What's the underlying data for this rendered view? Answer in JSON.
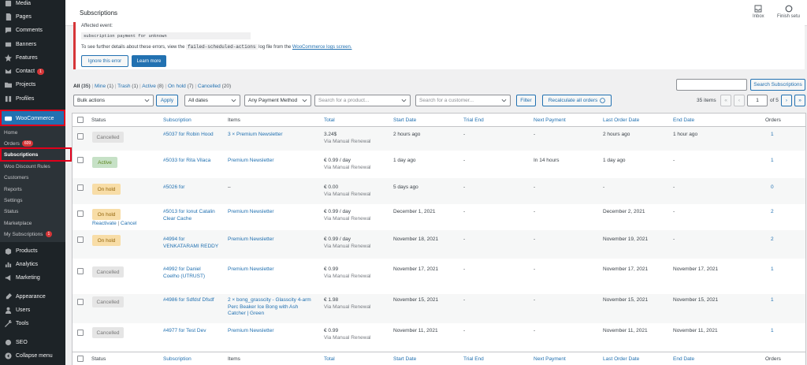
{
  "sidebar": {
    "items": [
      {
        "label": "Media",
        "icon": "media-icon"
      },
      {
        "label": "Pages",
        "icon": "pages-icon"
      },
      {
        "label": "Comments",
        "icon": "comments-icon"
      },
      {
        "label": "Banners",
        "icon": "banners-icon"
      },
      {
        "label": "Features",
        "icon": "features-icon"
      },
      {
        "label": "Contact",
        "icon": "contact-icon",
        "badge": "1"
      },
      {
        "label": "Projects",
        "icon": "projects-icon"
      },
      {
        "label": "Profiles",
        "icon": "profiles-icon"
      }
    ],
    "woocommerce": "WooCommerce",
    "submenu": [
      {
        "label": "Home"
      },
      {
        "label": "Orders",
        "badge": "609"
      },
      {
        "label": "Subscriptions"
      },
      {
        "label": "Woo Discount Rules"
      },
      {
        "label": "Customers"
      },
      {
        "label": "Reports"
      },
      {
        "label": "Settings"
      },
      {
        "label": "Status"
      },
      {
        "label": "Marketplace"
      },
      {
        "label": "My Subscriptions",
        "badge": "1"
      }
    ],
    "items2": [
      {
        "label": "Products",
        "icon": "products-icon"
      },
      {
        "label": "Analytics",
        "icon": "analytics-icon"
      },
      {
        "label": "Marketing",
        "icon": "marketing-icon"
      },
      {
        "label": "Appearance",
        "icon": "appearance-icon"
      },
      {
        "label": "Users",
        "icon": "users-icon"
      },
      {
        "label": "Tools",
        "icon": "tools-icon"
      },
      {
        "label": "SEO",
        "icon": "seo-icon"
      },
      {
        "label": "Collapse menu",
        "icon": "collapse-icon"
      }
    ]
  },
  "header": {
    "title": "Subscriptions",
    "inbox": "Inbox",
    "finish_setup": "Finish setu"
  },
  "notice": {
    "affected": "Affected event:",
    "code": "subscription payment for unknown",
    "line_a": "To see further details about these errors, view the",
    "line_code": "failed-scheduled-actions",
    "line_b": "log file from the",
    "link": "WooCommerce logs screen.",
    "ignore": "Ignore this error",
    "learn": "Learn more"
  },
  "views": {
    "all": "All",
    "all_count": "(35)",
    "mine": "Mine",
    "mine_count": "(1)",
    "trash": "Trash",
    "trash_count": "(1)",
    "active": "Active",
    "active_count": "(8)",
    "onhold": "On hold",
    "onhold_count": "(7)",
    "cancelled": "Cancelled",
    "cancelled_count": "(20)",
    "sep": "|"
  },
  "filters": {
    "bulk": "Bulk actions",
    "apply": "Apply",
    "dates": "All dates",
    "payment": "Any Payment Method",
    "product_ph": "Search for a product...",
    "customer_ph": "Search for a customer...",
    "filter": "Filter",
    "recalc": "Recalculate all orders",
    "search_btn": "Search Subscriptions",
    "items": "35 items",
    "first": "«",
    "prev": "‹",
    "page": "1",
    "of": "of 5",
    "next": "›",
    "last": "»"
  },
  "columns": {
    "status": "Status",
    "subscription": "Subscription",
    "items": "Items",
    "total": "Total",
    "start": "Start Date",
    "trial": "Trial End",
    "next": "Next Payment",
    "last": "Last Order Date",
    "end": "End Date",
    "orders": "Orders"
  },
  "rows": [
    {
      "status": "Cancelled",
      "kind": "cancelled",
      "id": "#5037",
      "for": "for Robin Hood",
      "items": "3 × Premium Newsletter",
      "total": "3.24$",
      "via": "Via Manual Renewal",
      "start": "2 hours ago",
      "trial": "-",
      "next": "-",
      "last": "2 hours ago",
      "end": "1 hour ago",
      "orders": "1"
    },
    {
      "status": "Active",
      "kind": "active",
      "id": "#5033",
      "for": "for Rita Vilaca",
      "items": "Premium Newsletter",
      "total": "€ 0.99 / day",
      "via": "Via Manual Renewal",
      "start": "1 day ago",
      "trial": "-",
      "next": "In 14 hours",
      "last": "1 day ago",
      "end": "-",
      "orders": "1"
    },
    {
      "status": "On hold",
      "kind": "onhold",
      "id": "#5026",
      "for": "for",
      "items": "–",
      "total": "€ 0.00",
      "via": "Via Manual Renewal",
      "start": "5 days ago",
      "trial": "-",
      "next": "-",
      "last": "-",
      "end": "-",
      "orders": "0"
    },
    {
      "status": "On hold",
      "kind": "onhold",
      "id": "#5013",
      "for": "for Ionut Catalin",
      "for2": "Clear Cache",
      "items": "Premium Newsletter",
      "total": "€ 0.99 / day",
      "via": "Via Manual Renewal",
      "start": "December 1, 2021",
      "trial": "-",
      "next": "-",
      "last": "December 2, 2021",
      "end": "-",
      "orders": "2",
      "actions": {
        "reactivate": "Reactivate",
        "sep": "|",
        "cancel": "Cancel"
      }
    },
    {
      "status": "On hold",
      "kind": "onhold",
      "id": "#4994",
      "for": "for",
      "for2": "VENKATARAMI REDDY",
      "items": "Premium Newsletter",
      "total": "€ 0.99 / day",
      "via": "Via Manual Renewal",
      "start": "November 18, 2021",
      "trial": "-",
      "next": "-",
      "last": "November 19, 2021",
      "end": "-",
      "orders": "2"
    },
    {
      "status": "Cancelled",
      "kind": "cancelled",
      "id": "#4992",
      "for": "for Daniel",
      "for2": "Coelho (UTRUST)",
      "items": "Premium Newsletter",
      "total": "€ 0.99",
      "via": "Via Manual Renewal",
      "start": "November 17, 2021",
      "trial": "-",
      "next": "-",
      "last": "November 17, 2021",
      "end": "November 17, 2021",
      "orders": "1"
    },
    {
      "status": "Cancelled",
      "kind": "cancelled",
      "id": "#4986",
      "for": "for Sdfdsf Dfsdf",
      "items": "2 × bong_grasscity - Glasscity 4-arm",
      "items2": "Perc Beaker Ice Bong with Ash",
      "items3": "Catcher | Green",
      "total": "€ 1.98",
      "via": "Via Manual Renewal",
      "start": "November 15, 2021",
      "trial": "-",
      "next": "-",
      "last": "November 15, 2021",
      "end": "November 15, 2021",
      "orders": "1"
    },
    {
      "status": "Cancelled",
      "kind": "cancelled",
      "id": "#4977",
      "for": "for Test Dev",
      "items": "Premium Newsletter",
      "total": "€ 0.99",
      "via": "Via Manual Renewal",
      "start": "November 11, 2021",
      "trial": "-",
      "next": "-",
      "last": "November 11, 2021",
      "end": "November 11, 2021",
      "orders": "1"
    }
  ],
  "colors": {
    "accent": "#2271b1",
    "sidebar": "#1d2327",
    "highlight": "#e0001b"
  }
}
